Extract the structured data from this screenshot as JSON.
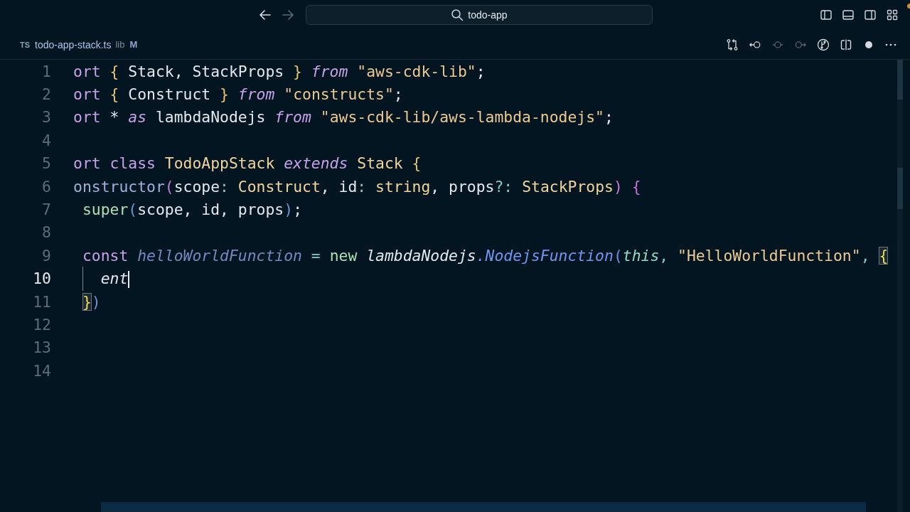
{
  "title_bar": {
    "nav_buttons": [
      {
        "kind": "back",
        "disabled": false
      },
      {
        "kind": "forward",
        "disabled": true
      }
    ],
    "search": {
      "value": "todo-app"
    },
    "layout_buttons": [
      {
        "kind": "sidebar-left"
      },
      {
        "kind": "panel"
      },
      {
        "kind": "sidebar-right"
      },
      {
        "kind": "grid"
      }
    ]
  },
  "tab": {
    "language_badge": "TS",
    "filename": "todo-app-stack.ts",
    "folder": "lib",
    "git_status": "M"
  },
  "editor_actions": [
    {
      "kind": "compare",
      "disabled": false
    },
    {
      "kind": "revert",
      "disabled": false
    },
    {
      "kind": "previous",
      "disabled": true
    },
    {
      "kind": "next",
      "disabled": true
    },
    {
      "kind": "graph",
      "disabled": false
    },
    {
      "kind": "split",
      "disabled": false
    },
    {
      "kind": "dirty",
      "disabled": false
    },
    {
      "kind": "more",
      "disabled": false
    }
  ],
  "editor": {
    "lines": [
      {
        "number": "1",
        "current": false,
        "tokens": [
          {
            "text": "ort ",
            "kind": "keyword"
          },
          {
            "text": "{ ",
            "kind": "brace"
          },
          {
            "text": "Stack, StackProps ",
            "kind": "plain"
          },
          {
            "text": "} ",
            "kind": "brace"
          },
          {
            "text": "from ",
            "kind": "keyword-italic"
          },
          {
            "text": "\"aws-cdk-lib\"",
            "kind": "string"
          },
          {
            "text": ";",
            "kind": "plain"
          }
        ]
      },
      {
        "number": "2",
        "current": false,
        "tokens": [
          {
            "text": "ort ",
            "kind": "keyword"
          },
          {
            "text": "{ ",
            "kind": "brace"
          },
          {
            "text": "Construct ",
            "kind": "plain"
          },
          {
            "text": "} ",
            "kind": "brace"
          },
          {
            "text": "from ",
            "kind": "keyword-italic"
          },
          {
            "text": "\"constructs\"",
            "kind": "string"
          },
          {
            "text": ";",
            "kind": "plain"
          }
        ]
      },
      {
        "number": "3",
        "current": false,
        "tokens": [
          {
            "text": "ort ",
            "kind": "keyword"
          },
          {
            "text": "* ",
            "kind": "plain"
          },
          {
            "text": "as ",
            "kind": "keyword-italic"
          },
          {
            "text": "lambdaNodejs ",
            "kind": "plain"
          },
          {
            "text": "from ",
            "kind": "keyword-italic"
          },
          {
            "text": "\"aws-cdk-lib/aws-lambda-nodejs\"",
            "kind": "string"
          },
          {
            "text": ";",
            "kind": "plain"
          }
        ]
      },
      {
        "number": "4",
        "current": false
      },
      {
        "number": "5",
        "current": false,
        "tokens": [
          {
            "text": "ort class ",
            "kind": "keyword"
          },
          {
            "text": "TodoAppStack ",
            "kind": "type"
          },
          {
            "text": "extends ",
            "kind": "keyword-italic"
          },
          {
            "text": "Stack ",
            "kind": "type"
          },
          {
            "text": "{",
            "kind": "brace"
          }
        ]
      },
      {
        "number": "6",
        "current": false,
        "tokens": [
          {
            "text": "onstructor",
            "kind": "method"
          },
          {
            "text": "(",
            "kind": "paren"
          },
          {
            "text": "scope",
            "kind": "plain"
          },
          {
            "text": ": ",
            "kind": "operator"
          },
          {
            "text": "Construct",
            "kind": "type"
          },
          {
            "text": ", id",
            "kind": "plain"
          },
          {
            "text": ": ",
            "kind": "operator"
          },
          {
            "text": "string",
            "kind": "type"
          },
          {
            "text": ", props",
            "kind": "plain"
          },
          {
            "text": "?: ",
            "kind": "operator"
          },
          {
            "text": "StackProps",
            "kind": "type"
          },
          {
            "text": ") ",
            "kind": "paren"
          },
          {
            "text": "{",
            "kind": "brace-purple"
          }
        ]
      },
      {
        "number": "7",
        "current": false,
        "tokens": [
          {
            "text": " super",
            "kind": "builtin"
          },
          {
            "text": "(",
            "kind": "paren-blue"
          },
          {
            "text": "scope, id, props",
            "kind": "plain"
          },
          {
            "text": ")",
            "kind": "paren-blue"
          },
          {
            "text": ";",
            "kind": "plain"
          }
        ]
      },
      {
        "number": "8",
        "current": false
      },
      {
        "number": "9",
        "current": false,
        "tokens": [
          {
            "text": " const ",
            "kind": "keyword"
          },
          {
            "text": "helloWorldFunction ",
            "kind": "variable"
          },
          {
            "text": "= ",
            "kind": "operator"
          },
          {
            "text": "new ",
            "kind": "builtin"
          },
          {
            "text": "lambdaNodejs",
            "kind": "plain-italic"
          },
          {
            "text": ".NodejsFunction",
            "kind": "function"
          },
          {
            "text": "(",
            "kind": "paren-blue"
          },
          {
            "text": "this",
            "kind": "this"
          },
          {
            "text": ", ",
            "kind": "operator"
          },
          {
            "text": "\"HelloWorldFunction\"",
            "kind": "string"
          },
          {
            "text": ", ",
            "kind": "operator"
          },
          {
            "text": "{",
            "kind": "matched-bracket"
          }
        ]
      },
      {
        "number": "10",
        "current": true,
        "indent_guide": true,
        "tokens": [
          {
            "text": "   ent",
            "kind": "plain-italic"
          }
        ]
      },
      {
        "number": "11",
        "current": false,
        "tokens": [
          {
            "text": " }",
            "kind": "matched-bracket"
          },
          {
            "text": ")",
            "kind": "paren-blue"
          }
        ]
      },
      {
        "number": "12",
        "current": false
      },
      {
        "number": "13",
        "current": false
      },
      {
        "number": "14",
        "current": false
      }
    ]
  }
}
